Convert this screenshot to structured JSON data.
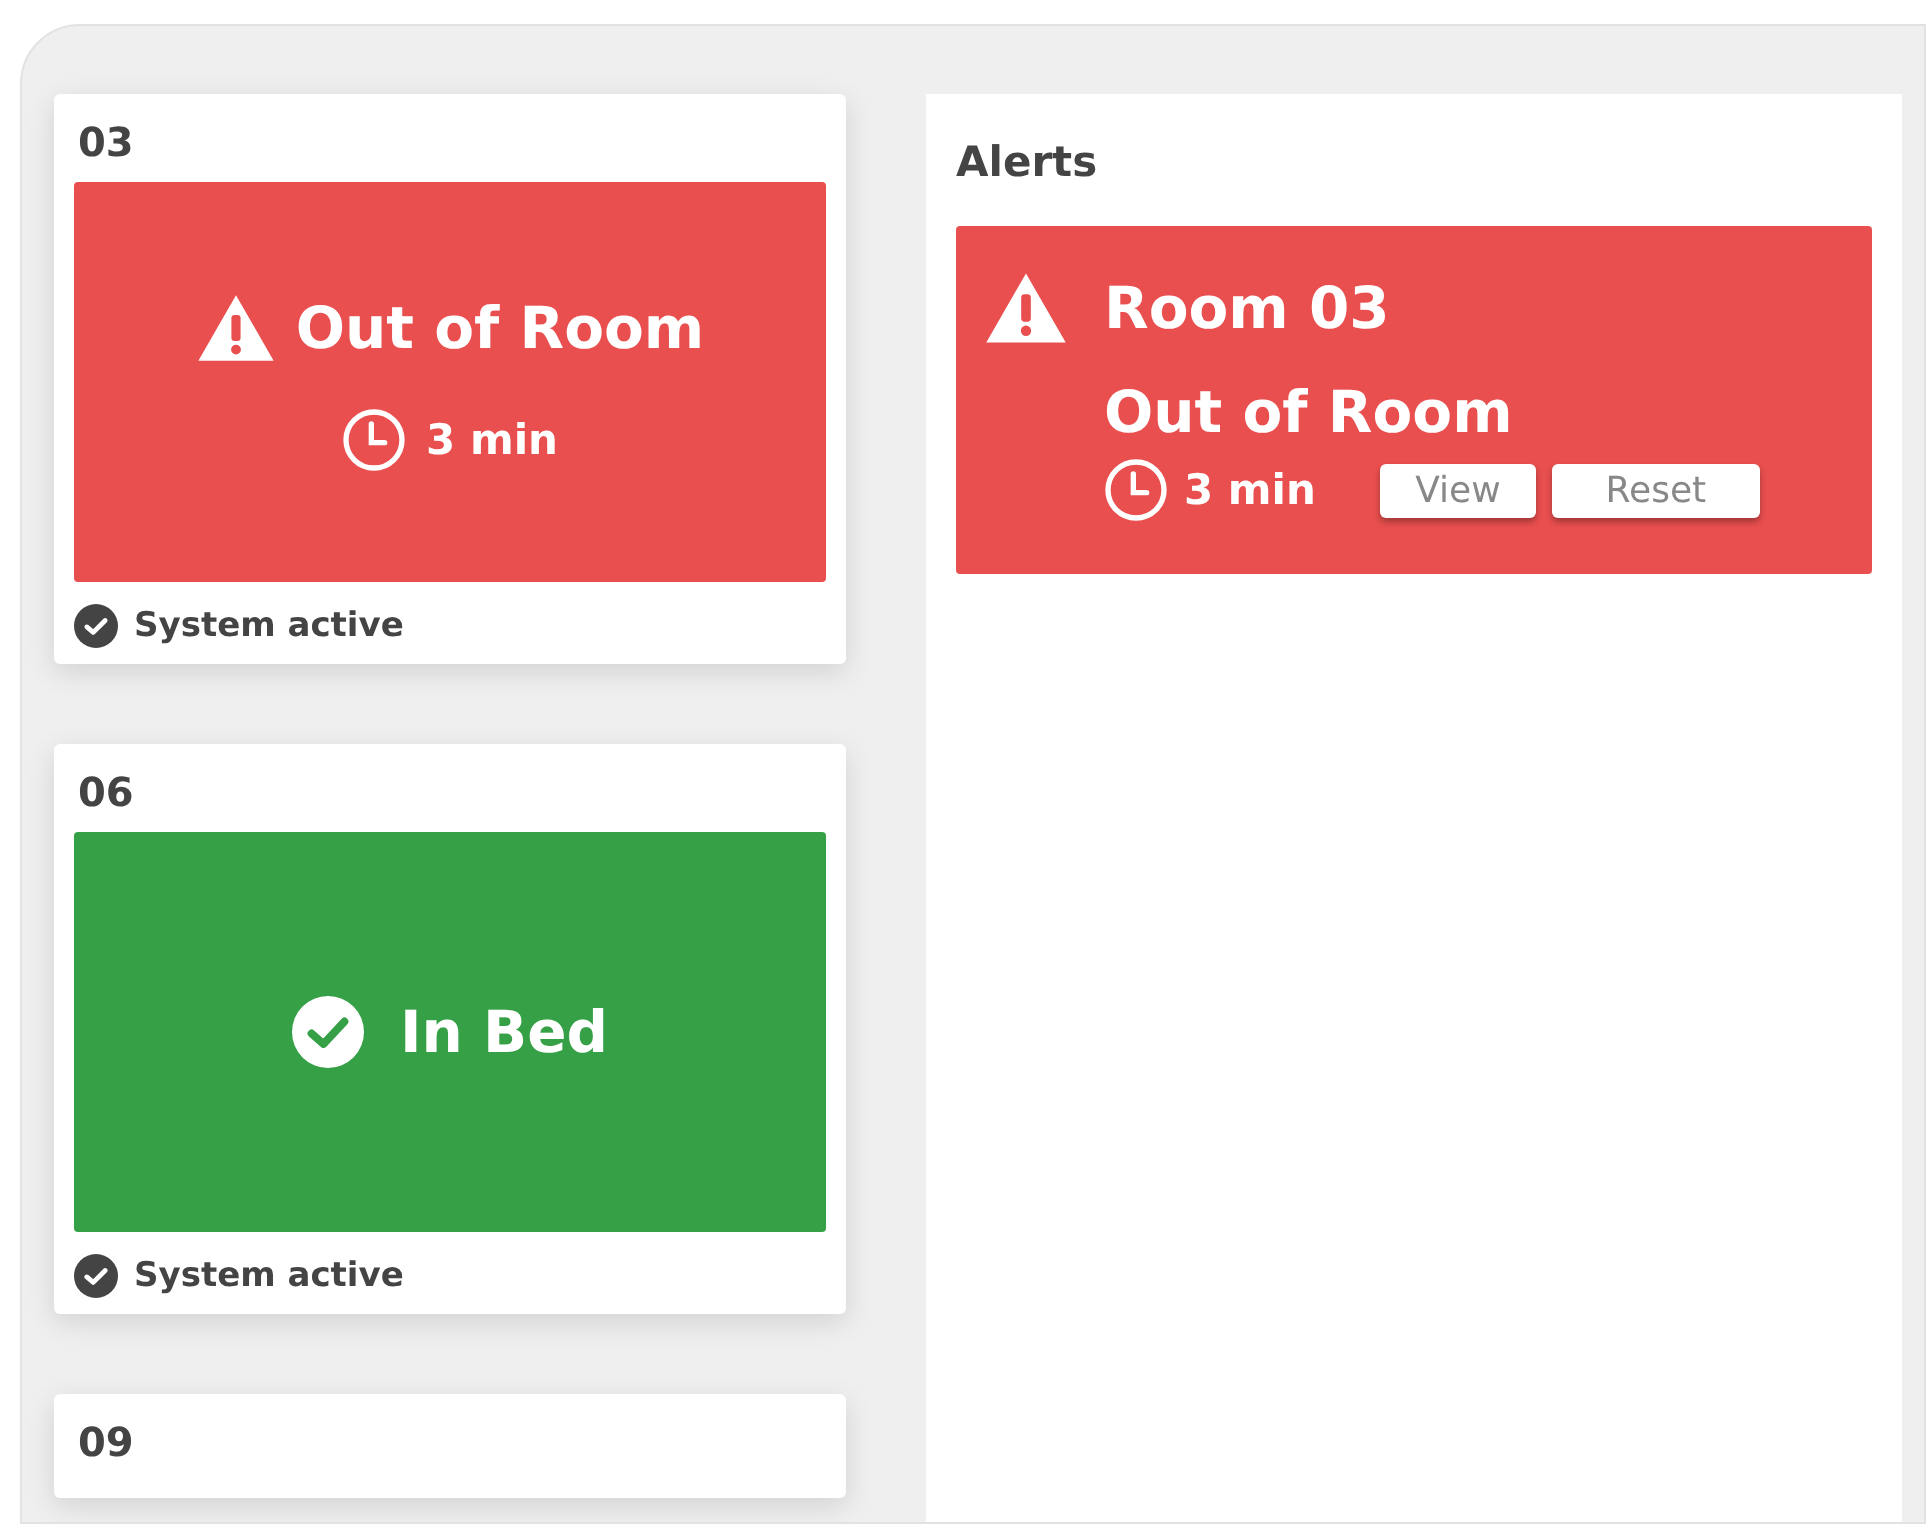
{
  "rooms": [
    {
      "number": "03",
      "status": {
        "kind": "alert",
        "label": "Out of Room",
        "duration": "3 min"
      },
      "system": "System active"
    },
    {
      "number": "06",
      "status": {
        "kind": "ok",
        "label": "In Bed"
      },
      "system": "System active"
    },
    {
      "number": "09"
    }
  ],
  "alerts_panel": {
    "title": "Alerts",
    "alerts": [
      {
        "kind": "alert",
        "room": "Room 03",
        "label": "Out of Room",
        "duration": "3 min",
        "buttons": [
          "View",
          "Reset"
        ]
      }
    ]
  }
}
